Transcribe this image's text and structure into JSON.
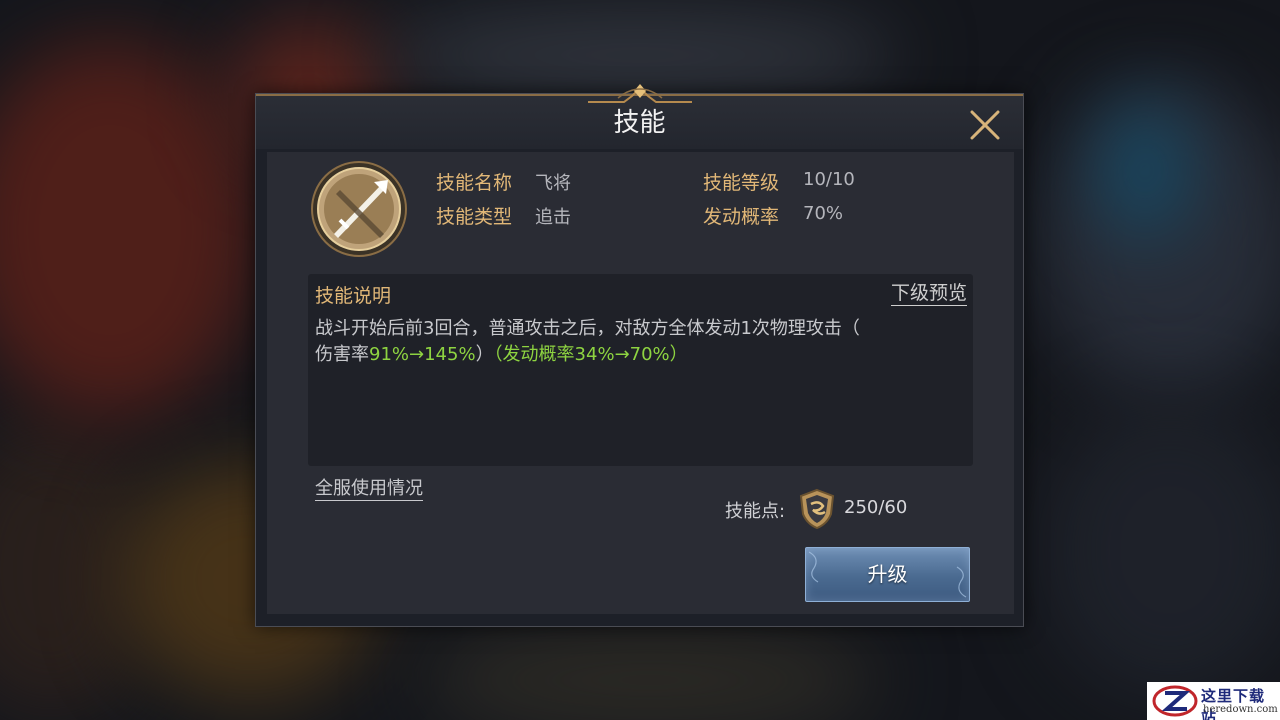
{
  "dialog": {
    "title": "技能"
  },
  "skill": {
    "name_label": "技能名称",
    "name_value": "飞将",
    "level_label": "技能等级",
    "level_value": "10/10",
    "type_label": "技能类型",
    "type_value": "追击",
    "chance_label": "发动概率",
    "chance_value": "70%"
  },
  "description": {
    "title": "技能说明",
    "preview_link": "下级预览",
    "line1": "战斗开始后前3回合，普通攻击之后，对敌方全体发动1次物理攻击（",
    "line2_prefix": "伤害率",
    "line2_damage": "91%→145%",
    "line2_close": "）",
    "line2_chance": "（发动概率34%→70%）"
  },
  "footer": {
    "server_usage_link": "全服使用情况",
    "points_label": "技能点:",
    "points_value": "250/60",
    "upgrade_label": "升级"
  },
  "watermark": {
    "title": "这里下载站",
    "subtitle": "heredown.com"
  },
  "icons": {
    "close": "close-icon",
    "skill": "crossed-swords-icon",
    "points": "shield-emblem-icon"
  },
  "colors": {
    "label_gold": "#e1b777",
    "highlight_green": "#8ed441",
    "button_blue": "#4a6a90"
  }
}
